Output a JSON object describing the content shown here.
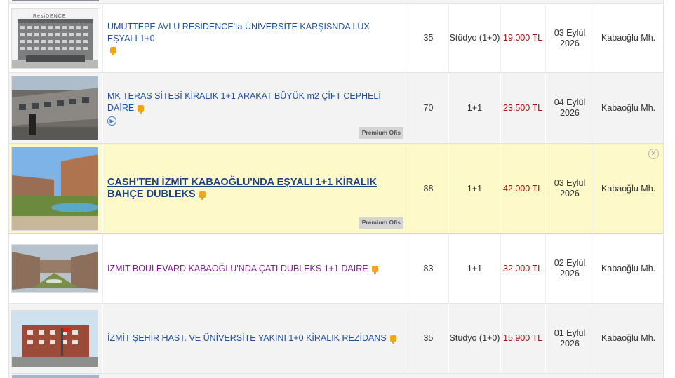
{
  "listings": [
    {
      "title": "UMUTTEPE AVLU RESİDENCE'ta ÜNİVERSİTE KARŞISNDA LÜX EŞYALI 1+0",
      "image_label": "ResiDENCE",
      "m2": "35",
      "rooms": "Stüdyo (1+0)",
      "price": "19.000 TL",
      "date_day": "03 Eylül",
      "date_year": "2026",
      "location": "Kabaoğlu Mh."
    },
    {
      "title": "MK TERAS SİTESİ KİRALIK 1+1 ARAKAT BÜYÜK m2 ÇİFT CEPHELİ DAİRE",
      "m2": "70",
      "rooms": "1+1",
      "price": "23.500 TL",
      "date_day": "04 Eylül",
      "date_year": "2026",
      "location": "Kabaoğlu Mh.",
      "badge": "Premium Ofis"
    },
    {
      "title": "CASH'TEN İZMİT KABAOĞLU'NDA EŞYALI 1+1 KİRALIK BAHÇE DUBLEKS",
      "m2": "88",
      "rooms": "1+1",
      "price": "42.000 TL",
      "date_day": "03 Eylül",
      "date_year": "2026",
      "location": "Kabaoğlu Mh.",
      "badge": "Premium Ofis"
    },
    {
      "title": "İZMİT BOULEVARD KABAOĞLU'NDA ÇATI DUBLEKS 1+1 DAİRE",
      "m2": "83",
      "rooms": "1+1",
      "price": "32.000 TL",
      "date_day": "02 Eylül",
      "date_year": "2026",
      "location": "Kabaoğlu Mh."
    },
    {
      "title": "İZMİT ŞEHİR HAST. VE ÜNİVERSİTE YAKINI 1+0 KİRALIK REZİDANS",
      "m2": "35",
      "rooms": "Stüdyo (1+0)",
      "price": "15.900 TL",
      "date_day": "01 Eylül",
      "date_year": "2026",
      "location": "Kabaoğlu Mh."
    }
  ],
  "icons": {
    "pin": "map-pin-icon",
    "video": "play-circle-icon",
    "close": "close-circle-icon"
  },
  "colors": {
    "link": "#1f4fa1",
    "visited_link": "#7a1f8a",
    "price": "#a3140c",
    "highlight_row": "#fdf9c9",
    "pin": "#f2a516"
  }
}
